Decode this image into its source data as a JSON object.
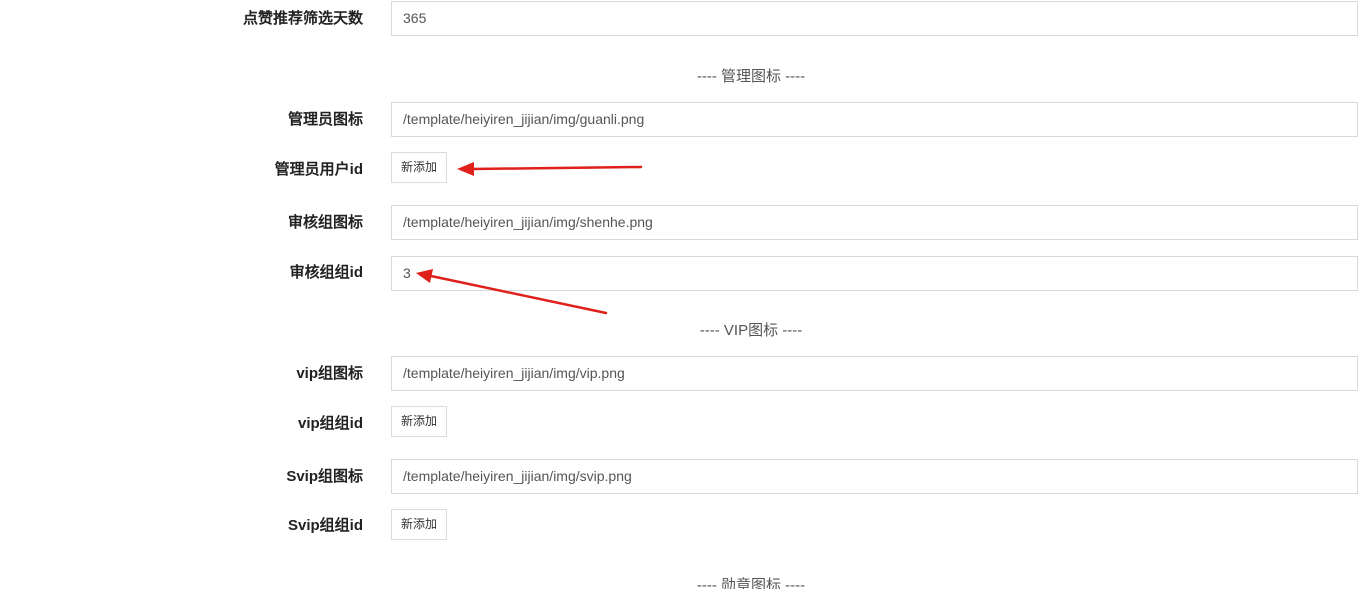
{
  "rows": {
    "like_days": {
      "label": "点赞推荐筛选天数",
      "value": "365"
    },
    "admin_icon": {
      "label": "管理员图标",
      "value": "/template/heiyiren_jijian/img/guanli.png"
    },
    "admin_uid": {
      "label": "管理员用户id",
      "button": "新添加"
    },
    "review_icon": {
      "label": "审核组图标",
      "value": "/template/heiyiren_jijian/img/shenhe.png"
    },
    "review_gid": {
      "label": "审核组组id",
      "value": "3"
    },
    "vip_icon": {
      "label": "vip组图标",
      "value": "/template/heiyiren_jijian/img/vip.png"
    },
    "vip_gid": {
      "label": "vip组组id",
      "button": "新添加"
    },
    "svip_icon": {
      "label": "Svip组图标",
      "value": "/template/heiyiren_jijian/img/svip.png"
    },
    "svip_gid": {
      "label": "Svip组组id",
      "button": "新添加"
    }
  },
  "sections": {
    "admin": "---- 管理图标 ----",
    "vip": "---- VIP图标 ----",
    "medal": "---- 勋章图标 ----"
  },
  "annotation_color": "#e0201b"
}
